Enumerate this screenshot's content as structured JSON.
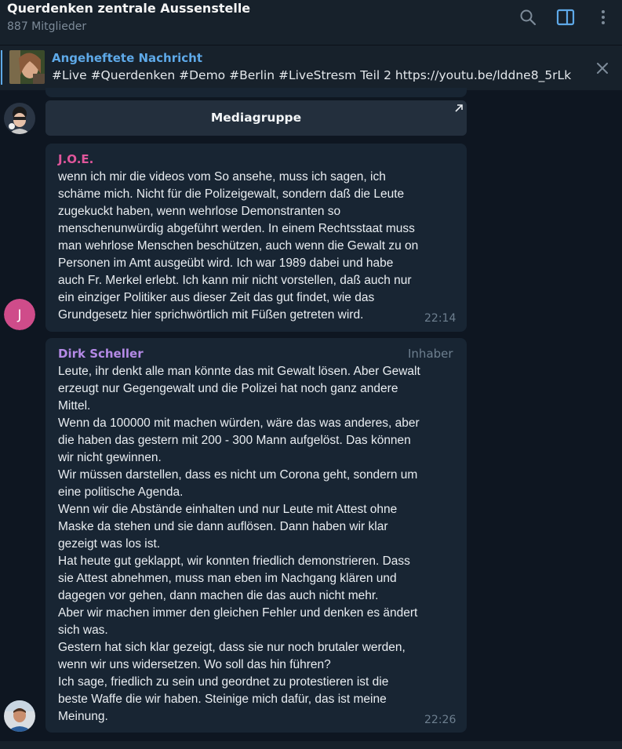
{
  "header": {
    "title": "Querdenken zentrale Aussenstelle",
    "members": "887 Mitglieder",
    "icons": [
      "search-icon",
      "sidebar-toggle-icon",
      "more-vert-icon"
    ],
    "accent": "#5ea9e8"
  },
  "pinned": {
    "title": "Angeheftete Nachricht",
    "text": "#Live #Querdenken #Demo #Berlin #LiveStresm Teil 2 https://youtu.be/lddne8_5rLk"
  },
  "media_group": {
    "label": "Mediagruppe"
  },
  "messages": [
    {
      "sender": "J.O.E.",
      "sender_color": "#e0569b",
      "avatar_letter": "J",
      "avatar_color": "#cf4c8a",
      "time": "22:14",
      "lines": [
        "wenn ich mir die videos vom So ansehe,  muss ich sagen, ich",
        "schäme mich. Nicht für die Polizeigewalt, sondern daß die Leute",
        "zugekuckt haben, wenn wehrlose Demonstranten so",
        "menschenunwürdig abgeführt werden. In einem Rechtsstaat muss",
        "man wehrlose Menschen beschützen, auch wenn die Gewalt zu on",
        "Personen im Amt ausgeübt wird. Ich war 1989 dabei und habe",
        "auch Fr. Merkel erlebt. Ich kann mir nicht vorstellen, daß auch nur",
        "ein einziger Politiker aus dieser Zeit das gut findet, wie das",
        "Grundgesetz hier sprichwörtlich mit Füßen getreten wird."
      ]
    },
    {
      "sender": "Dirk Scheller",
      "sender_color": "#b48ae6",
      "role": "Inhaber",
      "time": "22:26",
      "lines": [
        "Leute, ihr denkt alle man könnte das mit Gewalt lösen. Aber Gewalt",
        "erzeugt nur Gegengewalt und die Polizei hat noch ganz andere",
        "Mittel.",
        "Wenn da 100000 mit machen würden, wäre das was anderes, aber",
        "die haben das gestern mit 200 - 300 Mann aufgelöst. Das können",
        "wir nicht gewinnen.",
        "Wir müssen darstellen, dass es nicht um Corona geht, sondern um",
        "eine politische Agenda.",
        "Wenn wir die Abstände einhalten und nur Leute mit Attest ohne",
        "Maske da stehen und sie dann auflösen. Dann haben wir klar",
        "gezeigt was los ist.",
        "Hat heute gut geklappt, wir konnten friedlich demonstrieren. Dass",
        "sie Attest abnehmen, muss man eben im Nachgang klären und",
        "dagegen vor gehen, dann machen die das auch nicht mehr.",
        "Aber wir machen immer den gleichen Fehler und denken es ändert",
        "sich was.",
        "Gestern hat sich klar gezeigt, dass sie nur noch brutaler werden,",
        "wenn wir uns widersetzen. Wo soll das hin führen?",
        "Ich sage, friedlich zu sein und geordnet zu protestieren ist die",
        "beste Waffe die wir haben. Steinige mich dafür, das ist meine",
        "Meinung."
      ]
    }
  ]
}
